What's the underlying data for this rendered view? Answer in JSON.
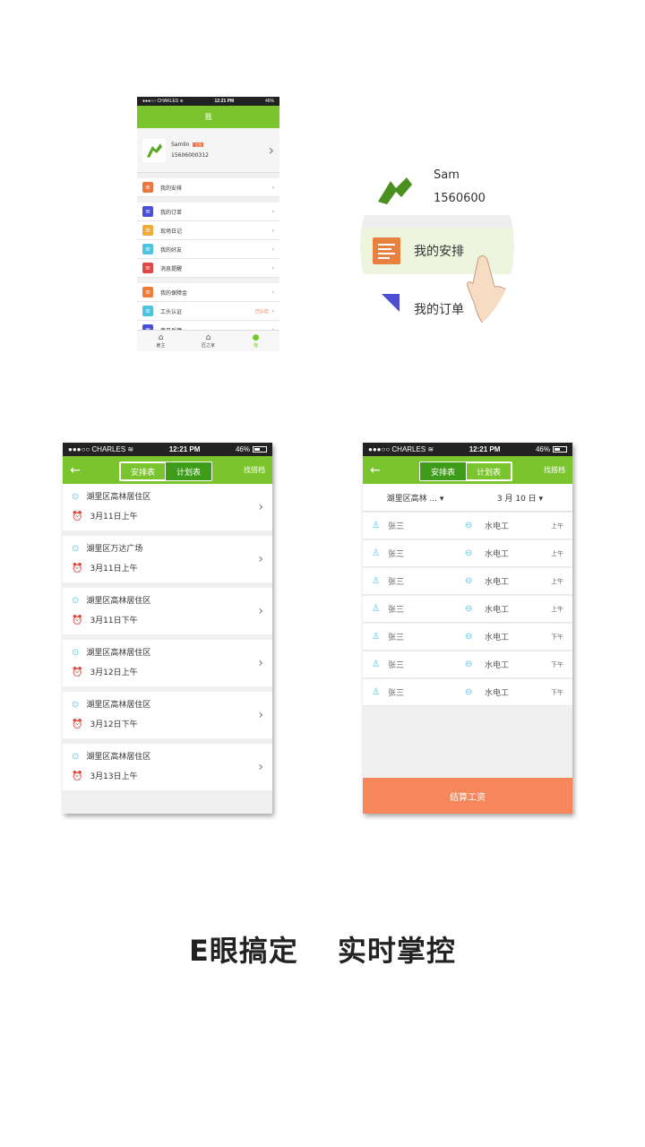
{
  "status": {
    "carrier": "●●●○○ CHARLES ≋",
    "time": "12:21 PM",
    "battery": "46%"
  },
  "profile_screen": {
    "title": "我",
    "user": {
      "name": "Samlin",
      "badge": "工头",
      "phone": "15606000312"
    },
    "menu": [
      {
        "label": "我的安排",
        "icon": "list-icon",
        "color": "#e8763e"
      },
      {
        "label": "我的订单",
        "icon": "tag-icon",
        "color": "#4a4fd6"
      },
      {
        "label": "现场日记",
        "icon": "diary-icon",
        "color": "#f1a93a"
      },
      {
        "label": "我的好友",
        "icon": "friends-icon",
        "color": "#4ec3e0"
      },
      {
        "label": "消息提醒",
        "icon": "bell-icon",
        "color": "#e04848"
      },
      {
        "label": "我的保障金",
        "icon": "money-icon",
        "color": "#ef7b3b"
      },
      {
        "label": "工头认证",
        "icon": "cert-icon",
        "color": "#4ec3e0",
        "status": "已认证"
      },
      {
        "label": "意见反馈",
        "icon": "mail-icon",
        "color": "#4a4fd6"
      }
    ],
    "tabbar": [
      "雇主",
      "匠之家",
      "我"
    ]
  },
  "zoom": {
    "name_partial": "Sam",
    "phone_partial": "1560600",
    "highlight_label": "我的安排",
    "next_label": "我的订单"
  },
  "schedule_screen": {
    "tabs": [
      "安排表",
      "计划表"
    ],
    "right_action": "找搭档",
    "items": [
      {
        "location": "湖里区高林居住区",
        "time": "3月11日上午"
      },
      {
        "location": "湖里区万达广场",
        "time": "3月11日上午"
      },
      {
        "location": "湖里区高林居住区",
        "time": "3月11日下午"
      },
      {
        "location": "湖里区高林居住区",
        "time": "3月12日上午"
      },
      {
        "location": "湖里区高林居住区",
        "time": "3月12日下午"
      },
      {
        "location": "湖里区高林居住区",
        "time": "3月13日上午"
      }
    ]
  },
  "plan_screen": {
    "tabs": [
      "安排表",
      "计划表"
    ],
    "right_action": "找搭档",
    "filter_location": "湖里区高林 ...",
    "filter_date": "3 月 10 日",
    "workers": [
      {
        "name": "张三",
        "job": "水电工",
        "shift": "上午"
      },
      {
        "name": "张三",
        "job": "水电工",
        "shift": "上午"
      },
      {
        "name": "张三",
        "job": "水电工",
        "shift": "上午"
      },
      {
        "name": "张三",
        "job": "水电工",
        "shift": "上午"
      },
      {
        "name": "张三",
        "job": "水电工",
        "shift": "下午"
      },
      {
        "name": "张三",
        "job": "水电工",
        "shift": "下午"
      },
      {
        "name": "张三",
        "job": "水电工",
        "shift": "下午"
      }
    ],
    "settle_button": "结算工资"
  },
  "slogan": [
    "E眼搞定",
    "实时掌控"
  ]
}
